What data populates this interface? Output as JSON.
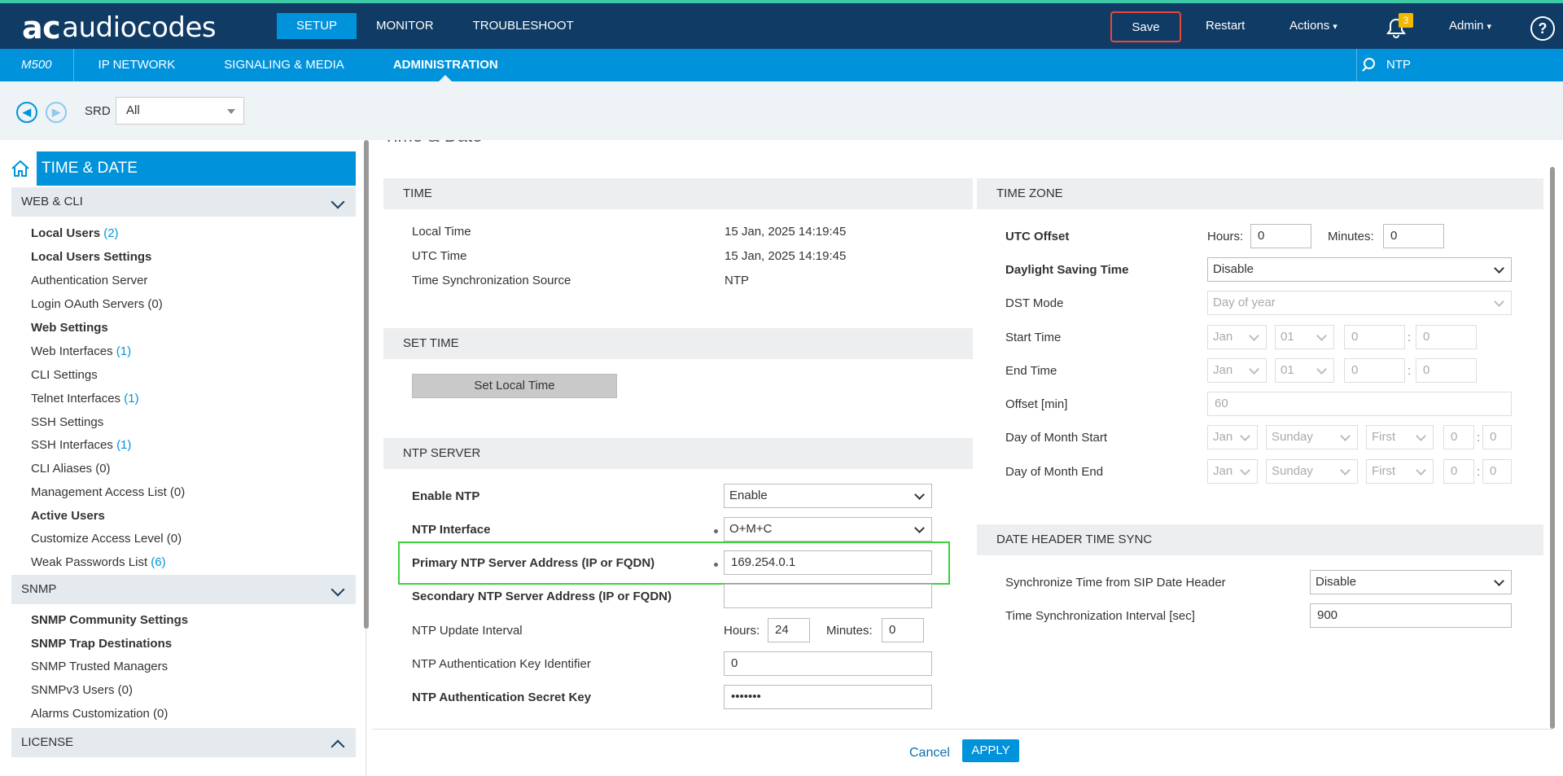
{
  "header": {
    "logo_mark": "ac",
    "logo_text": "audiocodes",
    "tabs": [
      "SETUP",
      "MONITOR",
      "TROUBLESHOOT"
    ],
    "save": "Save",
    "restart": "Restart",
    "actions": "Actions",
    "notifications": "3",
    "admin": "Admin",
    "help": "?"
  },
  "subnav": {
    "model": "M500",
    "tabs": [
      "IP NETWORK",
      "SIGNALING & MEDIA",
      "ADMINISTRATION"
    ],
    "search_value": "NTP"
  },
  "toolbar": {
    "srd_label": "SRD",
    "srd_value": "All"
  },
  "sidebar": {
    "title": "TIME & DATE",
    "groups": {
      "web_cli": "WEB & CLI",
      "snmp": "SNMP",
      "license": "LICENSE"
    },
    "web_items": [
      {
        "label": "Local Users",
        "count": "(2)"
      },
      {
        "label": "Local Users Settings",
        "count": ""
      },
      {
        "label": "Authentication Server",
        "count": ""
      },
      {
        "label": "Login OAuth Servers (0)",
        "count": ""
      },
      {
        "label": "Web Settings",
        "count": ""
      },
      {
        "label": "Web Interfaces",
        "count": "(1)"
      },
      {
        "label": "CLI Settings",
        "count": ""
      },
      {
        "label": "Telnet Interfaces",
        "count": "(1)"
      },
      {
        "label": "SSH Settings",
        "count": ""
      },
      {
        "label": "SSH Interfaces",
        "count": "(1)"
      },
      {
        "label": "CLI Aliases (0)",
        "count": ""
      },
      {
        "label": "Management Access List (0)",
        "count": ""
      },
      {
        "label": "Active Users",
        "count": ""
      },
      {
        "label": "Customize Access Level (0)",
        "count": ""
      },
      {
        "label": "Weak Passwords List",
        "count": "(6)"
      }
    ],
    "snmp_items": [
      "SNMP Community Settings",
      "SNMP Trap Destinations",
      "SNMP Trusted Managers",
      "SNMPv3 Users (0)",
      "Alarms Customization (0)"
    ]
  },
  "page_title": "Time & Date",
  "time": {
    "head": "TIME",
    "local_time_label": "Local Time",
    "local_time": "15 Jan, 2025 14:19:45",
    "utc_time_label": "UTC Time",
    "utc_time": "15 Jan, 2025 14:19:45",
    "sync_source_label": "Time Synchronization Source",
    "sync_source": "NTP"
  },
  "set_time": {
    "head": "SET TIME",
    "button": "Set Local Time"
  },
  "ntp": {
    "head": "NTP SERVER",
    "enable_label": "Enable NTP",
    "enable_value": "Enable",
    "interface_label": "NTP Interface",
    "interface_value": "O+M+C",
    "primary_label": "Primary NTP Server Address (IP or FQDN)",
    "primary_value": "169.254.0.1",
    "secondary_label": "Secondary NTP Server Address (IP or FQDN)",
    "secondary_value": "",
    "interval_label": "NTP Update Interval",
    "hours_label": "Hours:",
    "hours_value": "24",
    "minutes_label": "Minutes:",
    "minutes_value": "0",
    "key_id_label": "NTP Authentication Key Identifier",
    "key_id_value": "0",
    "secret_label": "NTP Authentication Secret Key",
    "secret_value": "•••••••"
  },
  "timezone": {
    "head": "TIME ZONE",
    "utc_label": "UTC Offset",
    "hours_label": "Hours:",
    "hours_value": "0",
    "minutes_label": "Minutes:",
    "minutes_value": "0",
    "dst_label": "Daylight Saving Time",
    "dst_value": "Disable",
    "dst_mode_label": "DST Mode",
    "dst_mode_value": "Day of year",
    "start_label": "Start Time",
    "end_label": "End Time",
    "month_value": "Jan",
    "day_value": "01",
    "zero": "0",
    "colon": ":",
    "offset_label": "Offset [min]",
    "offset_value": "60",
    "dom_start_label": "Day of Month Start",
    "dom_end_label": "Day of Month End",
    "weekday_value": "Sunday",
    "first_value": "First"
  },
  "date_header": {
    "head": "DATE HEADER TIME SYNC",
    "sync_label": "Synchronize Time from SIP Date Header",
    "sync_value": "Disable",
    "interval_label": "Time Synchronization Interval [sec]",
    "interval_value": "900"
  },
  "footer": {
    "cancel": "Cancel",
    "apply": "APPLY"
  }
}
